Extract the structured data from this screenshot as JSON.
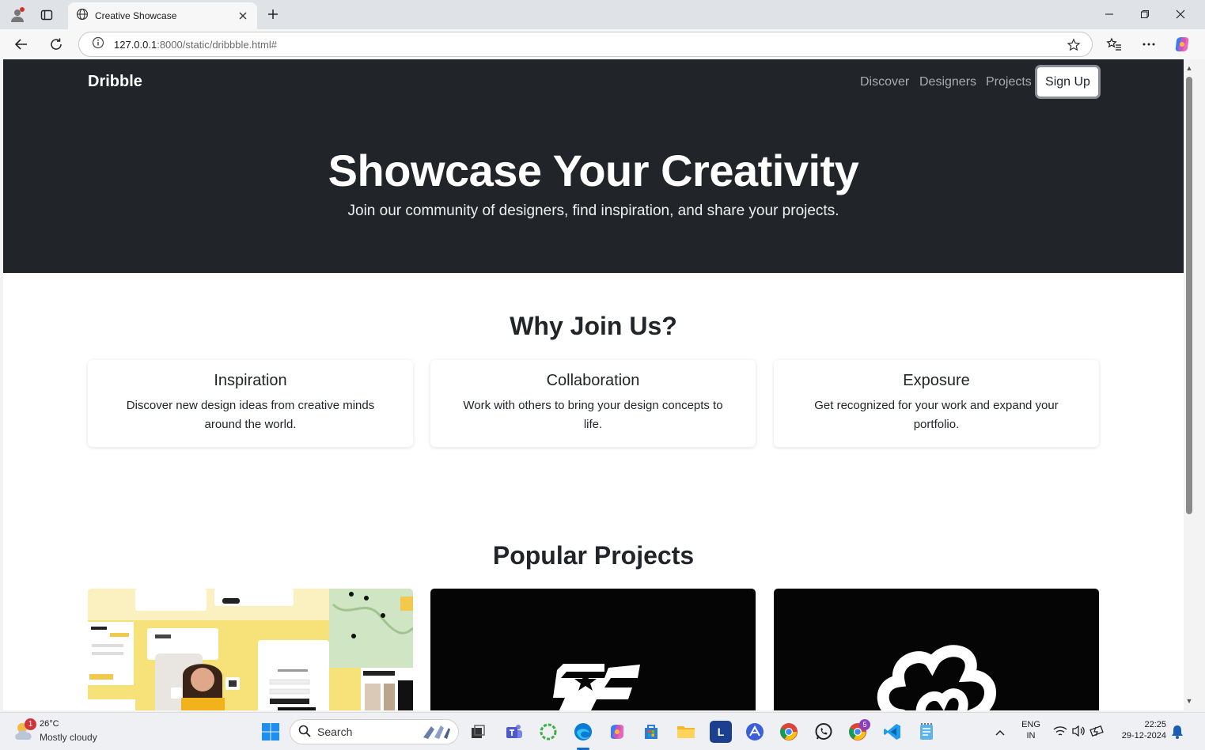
{
  "browser": {
    "tab_title": "Creative Showcase",
    "url_host": "127.0.0.1",
    "url_rest": ":8000/static/dribbble.html#"
  },
  "site": {
    "brand": "Dribble",
    "nav": [
      "Discover",
      "Designers",
      "Projects"
    ],
    "signup_label": "Sign Up",
    "hero_title": "Showcase Your Creativity",
    "hero_subtitle": "Join our community of designers, find inspiration, and share your projects.",
    "why_title": "Why Join Us?",
    "features": [
      {
        "title": "Inspiration",
        "text": "Discover new design ideas from creative minds around the world."
      },
      {
        "title": "Collaboration",
        "text": "Work with others to bring your design concepts to life."
      },
      {
        "title": "Exposure",
        "text": "Get recognized for your work and expand your portfolio."
      }
    ],
    "projects_title": "Popular Projects"
  },
  "taskbar": {
    "weather_temp": "26°C",
    "weather_desc": "Mostly cloudy",
    "weather_badge": "1",
    "search_label": "Search",
    "lang_line1": "ENG",
    "lang_line2": "IN",
    "time": "22:25",
    "date": "29-12-2024",
    "chrome_badge": "5",
    "l_app_letter": "L"
  }
}
